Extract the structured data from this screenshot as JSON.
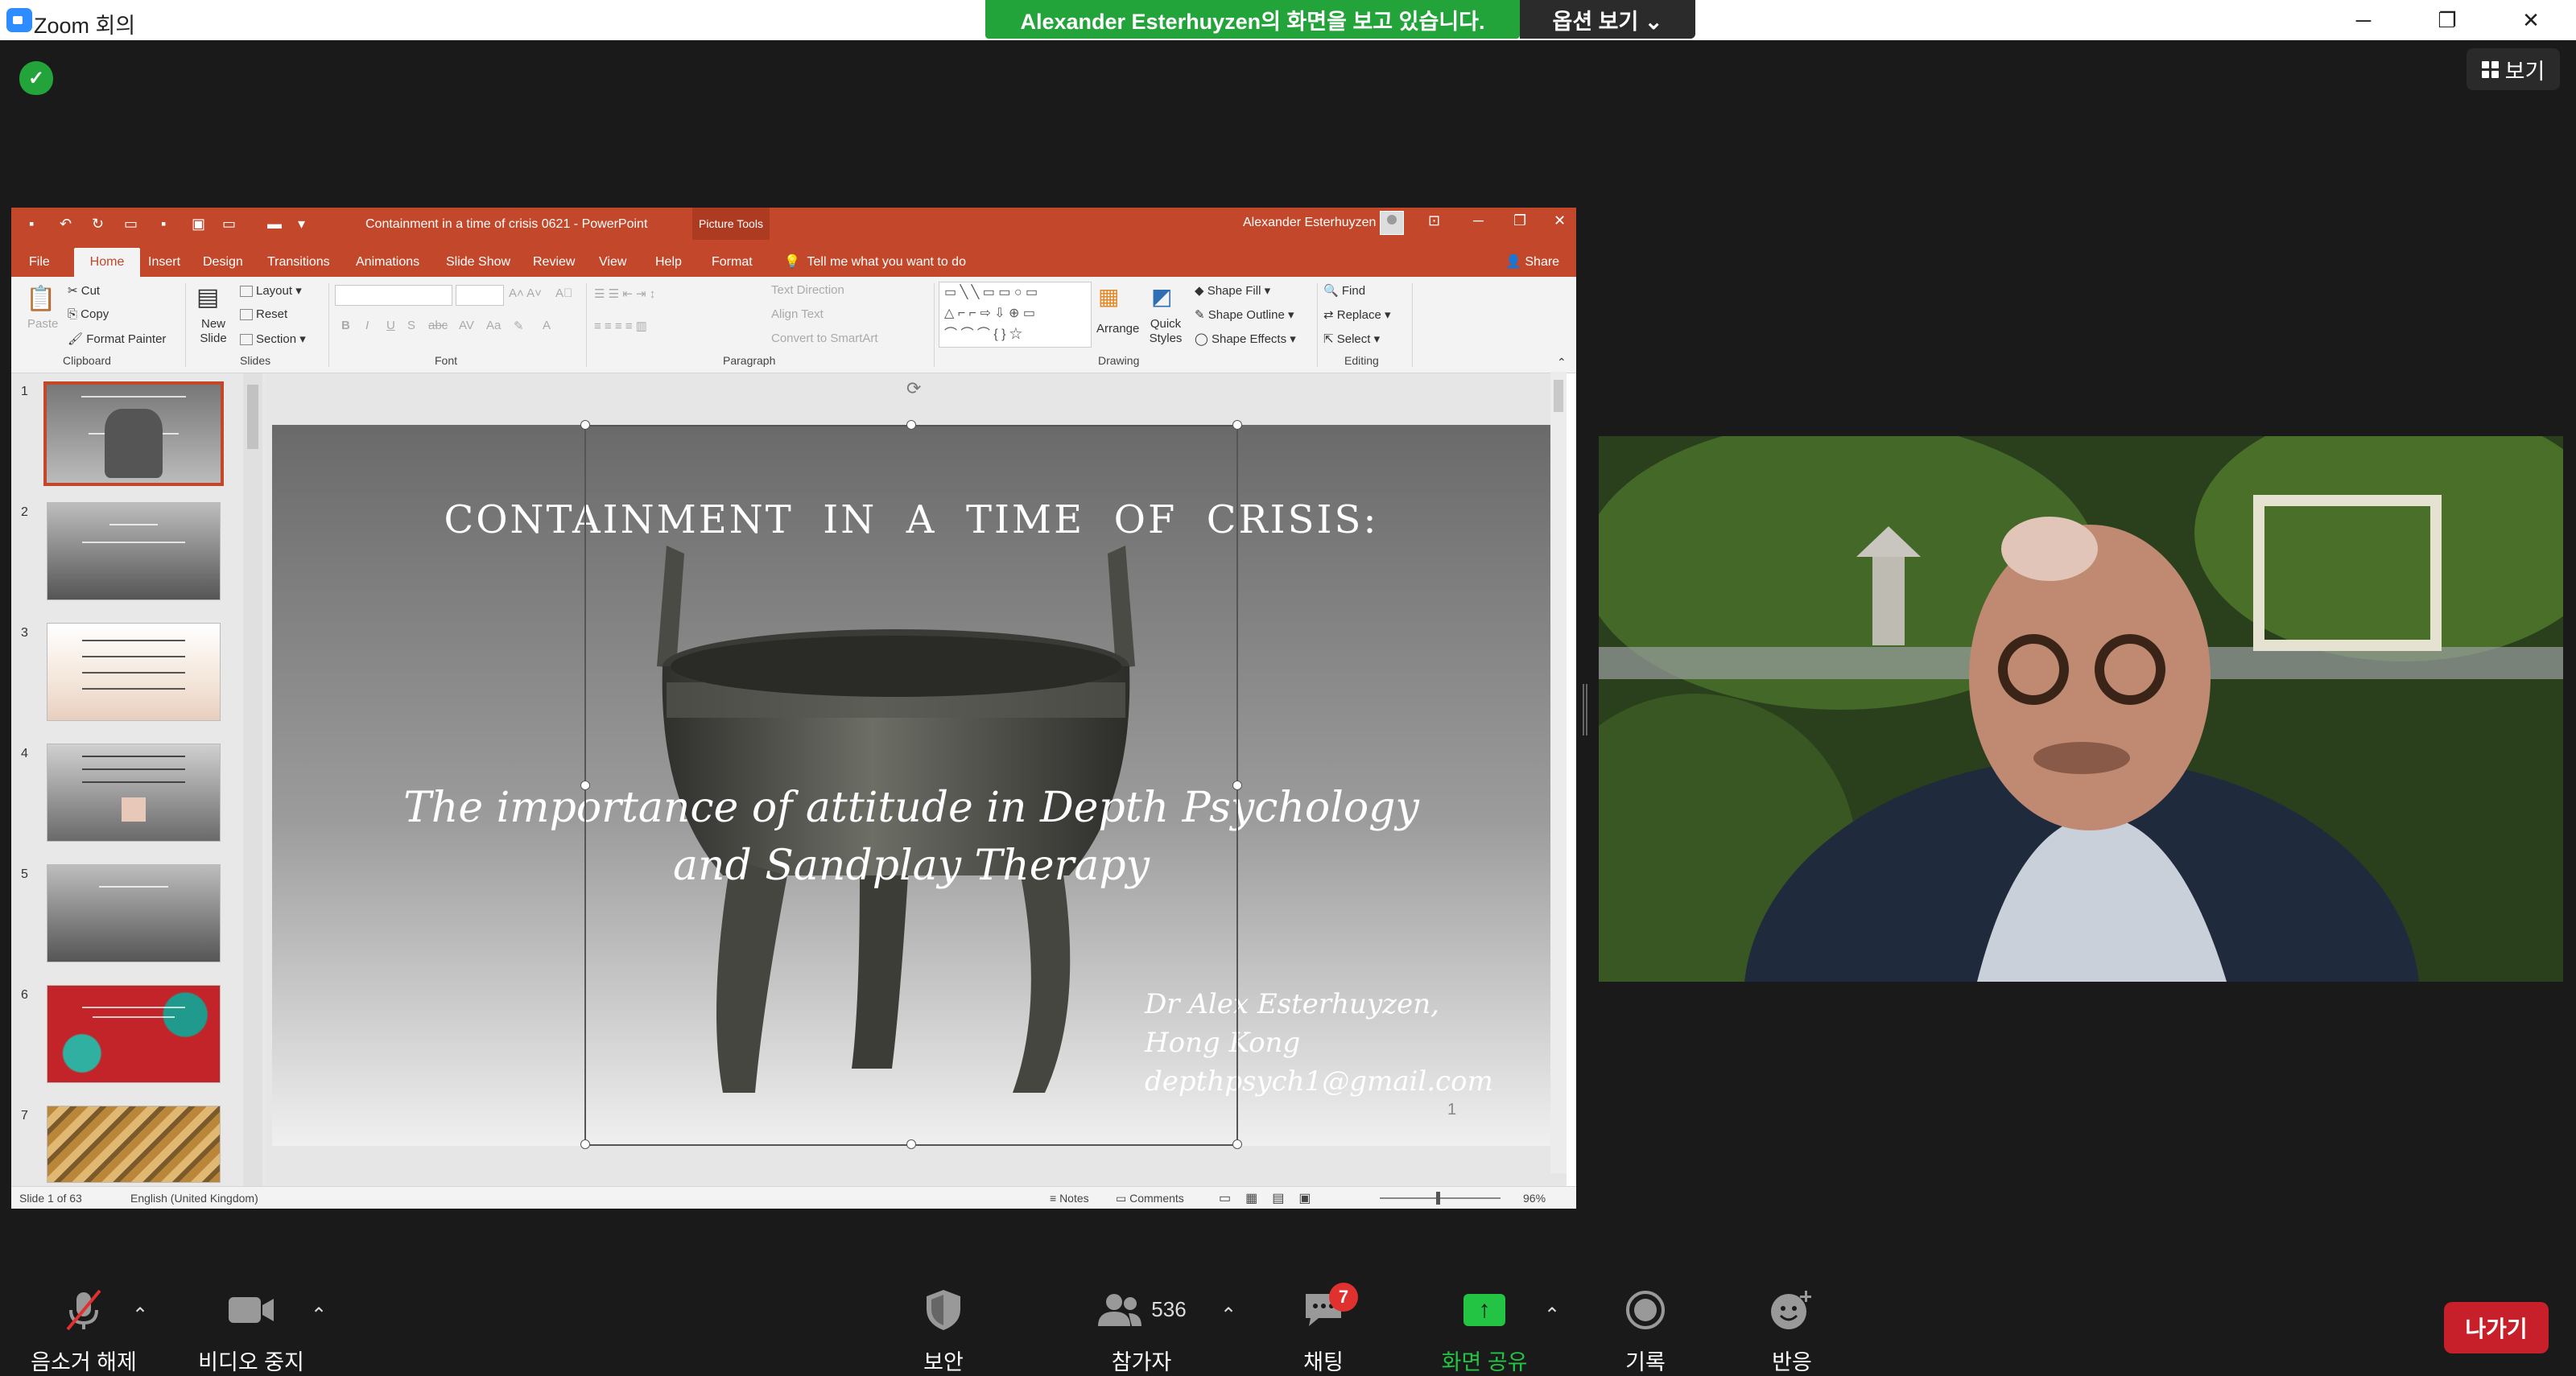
{
  "window": {
    "title": "Zoom 회의"
  },
  "share_banner": {
    "text": "Alexander  Esterhuyzen의 화면을 보고 있습니다.",
    "options_label": "옵션 보기 ⌄"
  },
  "top_right": {
    "view_label": "보기"
  },
  "powerpoint": {
    "doc_title": "Containment in a time of crisis 0621  -  PowerPoint",
    "picture_tools": "Picture Tools",
    "user": "Alexander Esterhuyzen",
    "tabs": [
      "File",
      "Home",
      "Insert",
      "Design",
      "Transitions",
      "Animations",
      "Slide Show",
      "Review",
      "View",
      "Help",
      "Format"
    ],
    "tell_me": "Tell me what you want to do",
    "share": "Share",
    "ribbon": {
      "clipboard": {
        "label": "Clipboard",
        "paste": "Paste",
        "cut": "Cut",
        "copy": "Copy",
        "format_painter": "Format Painter"
      },
      "slides": {
        "label": "Slides",
        "new_slide": "New Slide",
        "layout": "Layout",
        "reset": "Reset",
        "section": "Section"
      },
      "font": {
        "label": "Font"
      },
      "paragraph": {
        "label": "Paragraph",
        "text_direction": "Text Direction",
        "align_text": "Align Text",
        "convert_smartart": "Convert to SmartArt"
      },
      "drawing": {
        "label": "Drawing",
        "arrange": "Arrange",
        "quick_styles": "Quick Styles",
        "shape_fill": "Shape Fill",
        "shape_outline": "Shape Outline",
        "shape_effects": "Shape Effects"
      },
      "editing": {
        "label": "Editing",
        "find": "Find",
        "replace": "Replace",
        "select": "Select"
      }
    },
    "thumbnails": [
      "1",
      "2",
      "3",
      "4",
      "5",
      "6",
      "7"
    ],
    "slide": {
      "title": "CONTAINMENT  IN  A  TIME  OF  CRISIS:",
      "subtitle_1": "The importance of attitude in Depth Psychology",
      "subtitle_2": "and Sandplay Therapy",
      "author_1": "Dr Alex Esterhuyzen,",
      "author_2": "Hong Kong",
      "email": "depthpsych1@gmail.com",
      "slide_number": "1"
    },
    "status": {
      "slide_of": "Slide 1 of 63",
      "language": "English (United Kingdom)",
      "notes": "Notes",
      "comments": "Comments",
      "zoom": "96%"
    }
  },
  "toolbar": {
    "mute": "음소거 해제",
    "video": "비디오 중지",
    "security": "보안",
    "participants": "참가자",
    "participant_count": "536",
    "chat": "채팅",
    "chat_badge": "7",
    "share": "화면 공유",
    "record": "기록",
    "reactions": "반응",
    "leave": "나가기"
  },
  "colors": {
    "zoom_green": "#23a43a",
    "ppt_accent": "#c3472a",
    "leave_red": "#c8202a",
    "share_icon": "#23c343"
  }
}
